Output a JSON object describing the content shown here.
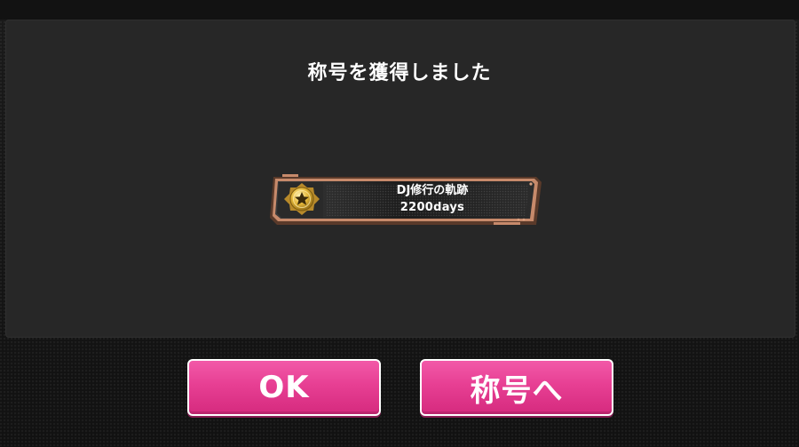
{
  "dialog": {
    "title": "称号を獲得しました"
  },
  "title_plate": {
    "name": "DJ修行の軌跡",
    "subtitle": "2200days",
    "emblem_icon": "gold-star-medal-icon"
  },
  "buttons": {
    "ok_label": "OK",
    "title_label": "称号へ"
  },
  "colors": {
    "button_pink": "#e73f93",
    "dialog_bg": "#272727",
    "plate_border": "#c78a6b",
    "medal_gold": "#e0b33a"
  }
}
